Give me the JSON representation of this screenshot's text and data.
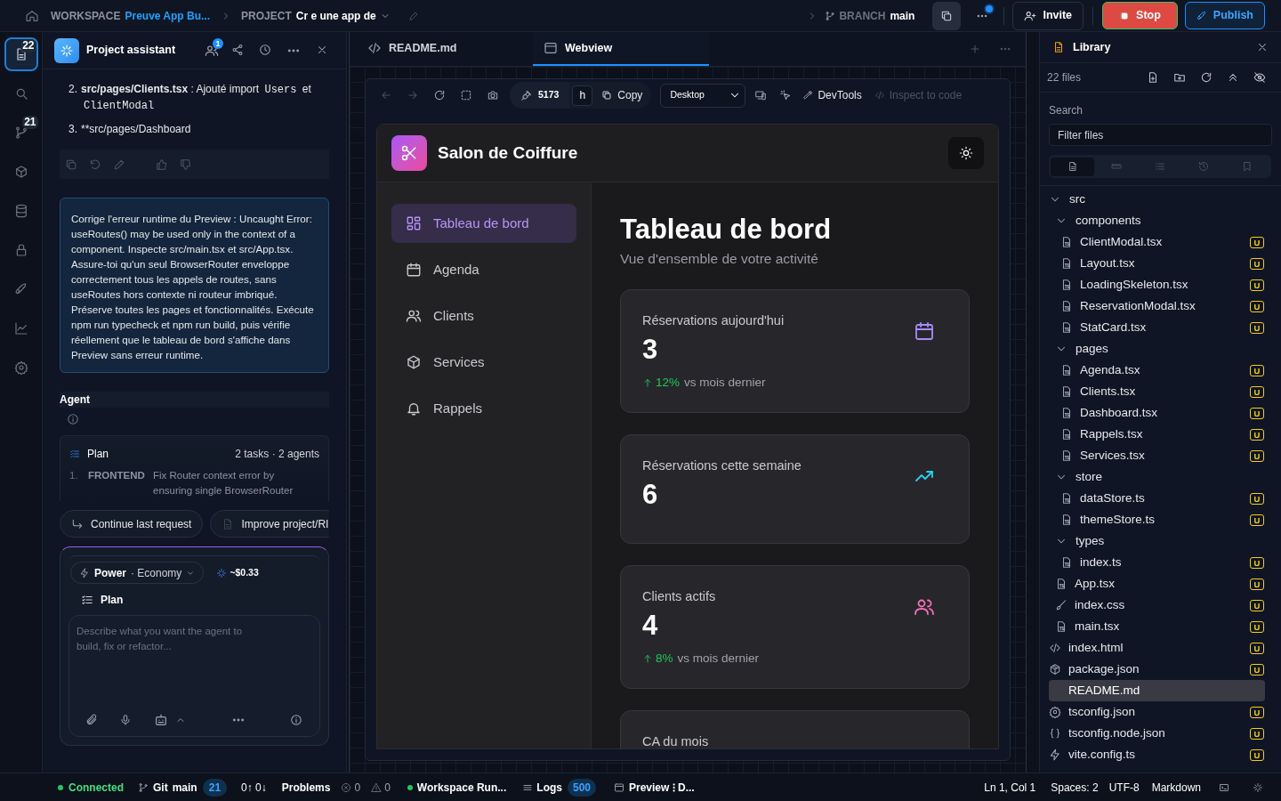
{
  "topbar": {
    "workspace_label": "WORKSPACE",
    "workspace": "Preuve App Bu...",
    "project_label": "PROJECT",
    "project": "Cr e une app de",
    "branch_label": "BRANCH",
    "branch": "main",
    "notification": true,
    "buttons": [
      {
        "kind": "invite",
        "label": "Invite"
      },
      {
        "kind": "stop",
        "label": "Stop"
      },
      {
        "kind": "publish",
        "label": "Publish"
      }
    ]
  },
  "activity_bar": [
    {
      "badge": "22",
      "selected": true
    },
    {
      "selected": false
    },
    {
      "badge": "21",
      "selected": false
    },
    {
      "selected": false
    },
    {
      "selected": false
    },
    {
      "selected": false
    },
    {
      "selected": false
    },
    {
      "selected": false
    },
    {
      "selected": false
    }
  ],
  "assistant": {
    "title": "Project assistant",
    "collaborators_badge": "1",
    "message_items": [
      {
        "number": "2.",
        "parts": [
          {
            "kind": "bold",
            "text": "src/pages/Clients.tsx"
          },
          {
            "kind": "text",
            "text": " : Ajouté import "
          },
          {
            "kind": "code",
            "text": "Users"
          },
          {
            "kind": "text",
            "text": " et "
          },
          {
            "kind": "code",
            "text": "ClientModal"
          }
        ]
      },
      {
        "number": "3.",
        "parts": [
          {
            "kind": "text",
            "text": "**src/pages/Dashboard"
          }
        ]
      }
    ],
    "prompt": "Corrige l'erreur runtime du Preview : Uncaught Error: useRoutes() may be used only in the context of a  component. Inspecte src/main.tsx et src/App.tsx. Assure-toi qu'un seul BrowserRouter enveloppe correctement tous les appels de routes, sans useRoutes hors contexte ni routeur imbriqué. Préserve toutes les pages et fonctionnalités. Exécute npm run typecheck et npm run build, puis vérifie réellement que le tableau de bord s'affiche dans Preview sans erreur runtime.",
    "agent_label": "Agent",
    "plan": {
      "title": "Plan",
      "summary": "2 tasks · 2 agents",
      "tasks": [
        {
          "number": "1.",
          "agent": "FRONTEND",
          "text": "Fix Router context error by ensuring single BrowserRouter"
        }
      ]
    },
    "suggestions": [
      "Continue last request",
      "Improve project/RI"
    ],
    "composer": {
      "mode": "Power",
      "tier": "· Economy",
      "cost": "~$0.33",
      "plan_label": "Plan",
      "placeholder": "Describe what you want the agent to build, fix or refactor..."
    }
  },
  "editor": {
    "tabs": [
      {
        "label": "README.md",
        "selected": false
      },
      {
        "label": "Webview",
        "selected": true
      }
    ],
    "webview": {
      "port": "5173",
      "host_key": "h",
      "copy_label": "Copy",
      "device": "Desktop",
      "devtools_label": "DevTools",
      "inspect_label": "Inspect to code",
      "inspect_disabled": true,
      "app": {
        "brand": "Salon de Coiffure",
        "nav": [
          {
            "label": "Tableau de bord",
            "selected": true
          },
          {
            "label": "Agenda",
            "selected": false
          },
          {
            "label": "Clients",
            "selected": false
          },
          {
            "label": "Services",
            "selected": false
          },
          {
            "label": "Rappels",
            "selected": false
          }
        ],
        "heading": "Tableau de bord",
        "subheading": "Vue d'ensemble de votre activité",
        "stats": [
          {
            "label": "Réservations aujourd'hui",
            "value": "3",
            "trend": "12%",
            "trend_text": "vs mois dernier",
            "color": "#a78bfa"
          },
          {
            "label": "Réservations cette semaine",
            "value": "6",
            "color": "#22d3ee"
          },
          {
            "label": "Clients actifs",
            "value": "4",
            "trend": "8%",
            "trend_text": "vs mois dernier",
            "color": "#f472b6"
          },
          {
            "label": "CA du mois"
          }
        ]
      }
    }
  },
  "library": {
    "title": "Library",
    "count": "22 files",
    "search_label": "Search",
    "search_placeholder": "Filter files",
    "filter_tabs": [
      {
        "selected": true
      },
      {
        "selected": false
      },
      {
        "selected": false
      },
      {
        "selected": false
      },
      {
        "selected": false
      }
    ],
    "tree": [
      {
        "name": "src",
        "kind": "folder",
        "expanded": true,
        "children": [
          {
            "name": "components",
            "kind": "folder",
            "expanded": true,
            "children": [
              {
                "name": "ClientModal.tsx",
                "kind": "ts",
                "status": "U",
                "selected": false
              },
              {
                "name": "Layout.tsx",
                "kind": "ts",
                "status": "U",
                "selected": false
              },
              {
                "name": "LoadingSkeleton.tsx",
                "kind": "ts",
                "status": "U",
                "selected": false
              },
              {
                "name": "ReservationModal.tsx",
                "kind": "ts",
                "status": "U",
                "selected": false
              },
              {
                "name": "StatCard.tsx",
                "kind": "ts",
                "status": "U",
                "selected": false
              }
            ]
          },
          {
            "name": "pages",
            "kind": "folder",
            "expanded": true,
            "children": [
              {
                "name": "Agenda.tsx",
                "kind": "ts",
                "status": "U",
                "selected": false
              },
              {
                "name": "Clients.tsx",
                "kind": "ts",
                "status": "U",
                "selected": false
              },
              {
                "name": "Dashboard.tsx",
                "kind": "ts",
                "status": "U",
                "selected": false
              },
              {
                "name": "Rappels.tsx",
                "kind": "ts",
                "status": "U",
                "selected": false
              },
              {
                "name": "Services.tsx",
                "kind": "ts",
                "status": "U",
                "selected": false
              }
            ]
          },
          {
            "name": "store",
            "kind": "folder",
            "expanded": true,
            "children": [
              {
                "name": "dataStore.ts",
                "kind": "ts",
                "status": "U",
                "selected": false
              },
              {
                "name": "themeStore.ts",
                "kind": "ts",
                "status": "U",
                "selected": false
              }
            ]
          },
          {
            "name": "types",
            "kind": "folder",
            "expanded": true,
            "children": [
              {
                "name": "index.ts",
                "kind": "ts",
                "status": "U",
                "selected": false
              }
            ]
          },
          {
            "name": "App.tsx",
            "kind": "ts",
            "status": "U",
            "selected": false
          },
          {
            "name": "index.css",
            "kind": "css",
            "status": "U",
            "selected": false
          },
          {
            "name": "main.tsx",
            "kind": "ts",
            "status": "U",
            "selected": false
          }
        ]
      },
      {
        "name": "index.html",
        "kind": "html",
        "status": "U",
        "selected": false
      },
      {
        "name": "package.json",
        "kind": "package",
        "status": "U",
        "selected": false
      },
      {
        "name": "README.md",
        "kind": "md",
        "selected": true
      },
      {
        "name": "tsconfig.json",
        "kind": "config",
        "status": "U",
        "selected": false
      },
      {
        "name": "tsconfig.node.json",
        "kind": "json",
        "status": "U",
        "selected": false
      },
      {
        "name": "vite.config.ts",
        "kind": "vite",
        "status": "U",
        "selected": false
      }
    ]
  },
  "status_bar": {
    "connection": "Connected",
    "git_label": "Git",
    "git_branch": "main",
    "git_count": "21",
    "sync": "0↑ 0↓",
    "problems_label": "Problems",
    "errors": "0",
    "warnings": "0",
    "workspace": "Workspace Run...",
    "logs_label": "Logs",
    "logs_count": "500",
    "preview": "Preview ⁝ D...",
    "position": "Ln 1, Col 1",
    "spaces": "Spaces: 2",
    "encoding": "UTF-8",
    "language": "Markdown"
  }
}
